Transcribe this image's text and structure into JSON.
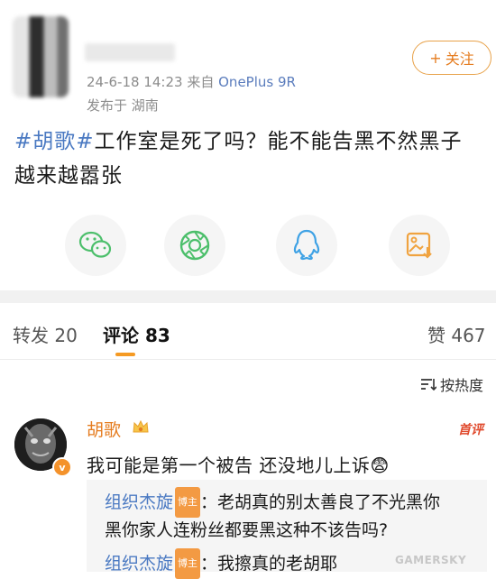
{
  "post": {
    "timestamp": "24-6-18 14:23",
    "source_prefix": "来自",
    "device": "OnePlus 9R",
    "location": "发布于 湖南",
    "follow_label": "关注",
    "follow_plus": "+",
    "hashtag": "#胡歌#",
    "body": "工作室是死了吗？能不能告黑不然黑子越来越嚣张"
  },
  "share_icons": [
    "wechat-icon",
    "moments-icon",
    "qq-icon",
    "save-image-icon"
  ],
  "tabs": {
    "repost": "转发 20",
    "comments": "评论 83",
    "likes": "赞 467"
  },
  "sort_label": "按热度",
  "comment": {
    "author": "胡歌",
    "badge": "v",
    "first_label": "首评",
    "text": "我可能是第一个被告 还没地儿上诉",
    "emoji": "😨"
  },
  "replies": [
    {
      "author": "组织杰旋",
      "tag": "博主",
      "text_line1": "：老胡真的别太善良了不光黑你",
      "text_line2": "黑你家人连粉丝都要黑这种不该告吗?"
    },
    {
      "author": "组织杰旋",
      "tag": "博主",
      "text_line1": "：我擦真的老胡耶"
    }
  ],
  "watermark": "GAMERSKY",
  "colors": {
    "accent_orange": "#e57c1f",
    "link_blue": "#4a79c2",
    "wechat_green": "#4cbf6b",
    "qq_blue": "#3fa2e5",
    "image_orange": "#f0a340"
  }
}
